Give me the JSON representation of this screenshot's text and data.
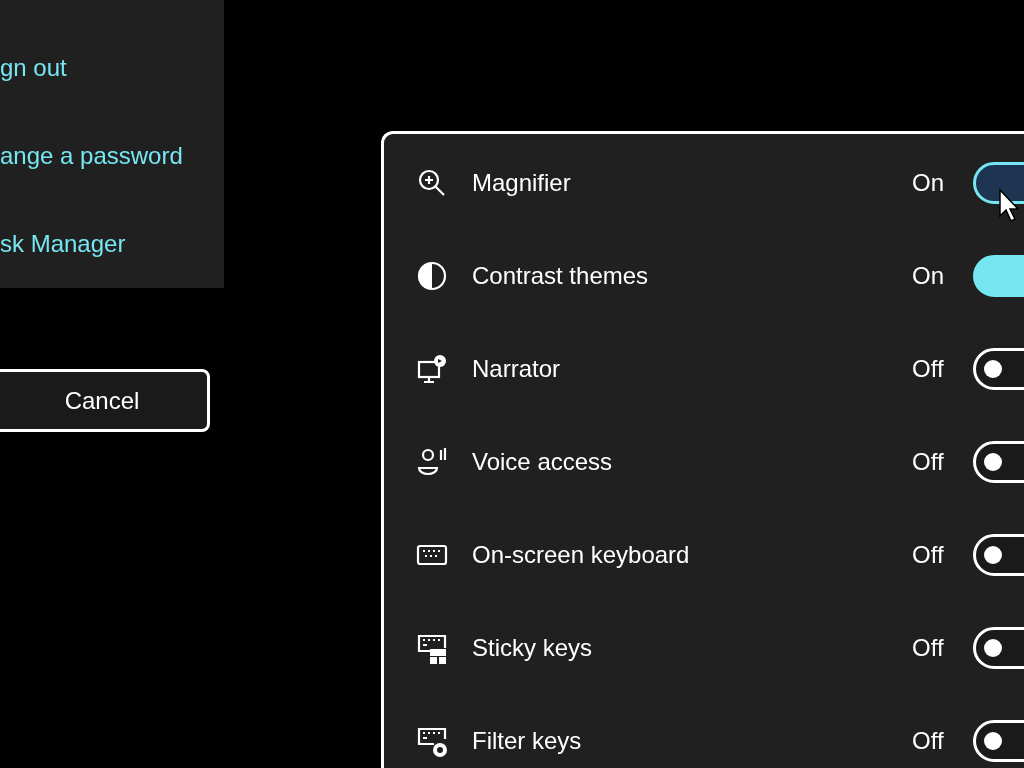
{
  "menu_links": [
    "gn out",
    "ange a password",
    "sk Manager"
  ],
  "cancel_button": "Cancel",
  "settings": [
    {
      "kind": "magnifier",
      "label": "Magnifier",
      "state_text": "On",
      "on": true,
      "hovered": true
    },
    {
      "kind": "contrast",
      "label": "Contrast themes",
      "state_text": "On",
      "on": true,
      "hovered": false
    },
    {
      "kind": "narrator",
      "label": "Narrator",
      "state_text": "Off",
      "on": false,
      "hovered": false
    },
    {
      "kind": "voice",
      "label": "Voice access",
      "state_text": "Off",
      "on": false,
      "hovered": false
    },
    {
      "kind": "keyboard",
      "label": "On-screen keyboard",
      "state_text": "Off",
      "on": false,
      "hovered": false
    },
    {
      "kind": "sticky",
      "label": "Sticky keys",
      "state_text": "Off",
      "on": false,
      "hovered": false
    },
    {
      "kind": "filter",
      "label": "Filter keys",
      "state_text": "Off",
      "on": false,
      "hovered": false
    }
  ]
}
